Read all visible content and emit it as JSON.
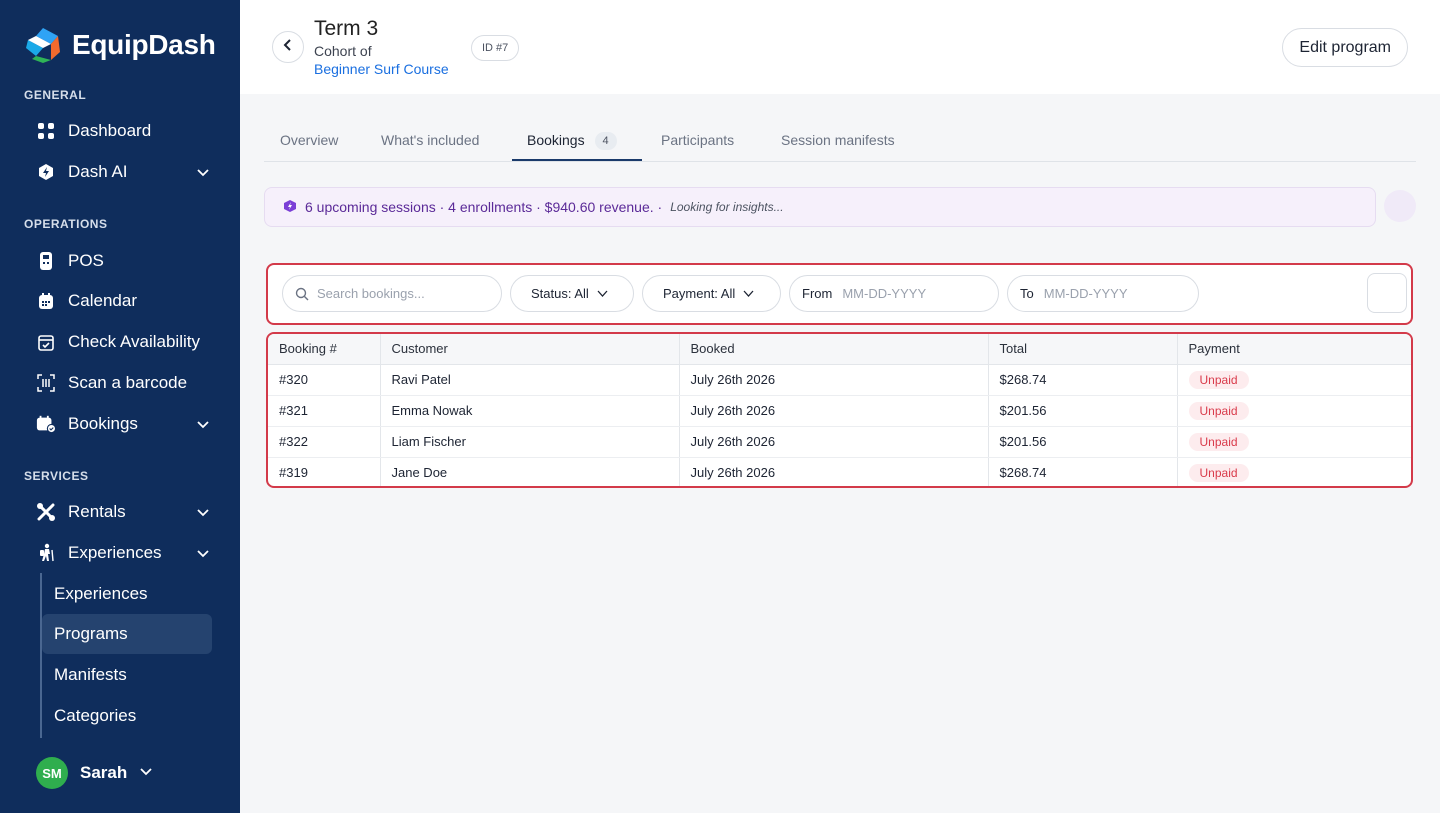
{
  "brand": {
    "name": "EquipDash"
  },
  "sidebar": {
    "sections": {
      "general": "GENERAL",
      "operations": "OPERATIONS",
      "services": "SERVICES"
    },
    "items": {
      "dashboard": "Dashboard",
      "dash_ai": "Dash AI",
      "pos": "POS",
      "calendar": "Calendar",
      "check_availability": "Check Availability",
      "scan_barcode": "Scan a barcode",
      "bookings": "Bookings",
      "rentals": "Rentals",
      "experiences": "Experiences"
    },
    "sub_items": [
      "Experiences",
      "Programs",
      "Manifests",
      "Categories"
    ],
    "active_sub_item": "Programs"
  },
  "user": {
    "initials": "SM",
    "name": "Sarah"
  },
  "header": {
    "title": "Term 3",
    "cohort_label": "Cohort of",
    "course_link": "Beginner Surf Course",
    "id_badge": "ID #7",
    "edit_button": "Edit program"
  },
  "tabs": [
    {
      "label": "Overview"
    },
    {
      "label": "What's included"
    },
    {
      "label": "Bookings",
      "count": "4",
      "active": true
    },
    {
      "label": "Participants"
    },
    {
      "label": "Session manifests"
    }
  ],
  "insight": {
    "summary": "6 upcoming sessions · 4 enrollments · $940.60 revenue. ·",
    "status": "Looking for insights..."
  },
  "filters": {
    "search_placeholder": "Search bookings...",
    "status": "Status: All",
    "payment": "Payment: All",
    "from_label": "From",
    "from_placeholder": "MM-DD-YYYY",
    "to_label": "To",
    "to_placeholder": "MM-DD-YYYY"
  },
  "table": {
    "columns": [
      "Booking #",
      "Customer",
      "Booked",
      "Total",
      "Payment"
    ],
    "rows": [
      [
        "#320",
        "Ravi Patel",
        "July 26th 2026",
        "$268.74",
        "Unpaid"
      ],
      [
        "#321",
        "Emma Nowak",
        "July 26th 2026",
        "$201.56",
        "Unpaid"
      ],
      [
        "#322",
        "Liam Fischer",
        "July 26th 2026",
        "$201.56",
        "Unpaid"
      ],
      [
        "#319",
        "Jane Doe",
        "July 26th 2026",
        "$268.74",
        "Unpaid"
      ]
    ]
  },
  "colors": {
    "sidebar_bg": "#0f2d5c",
    "accent_link": "#1a6fe0",
    "highlight_border": "#d33a4a",
    "unpaid": "#d93a4a",
    "insight_text": "#5b2a98"
  }
}
